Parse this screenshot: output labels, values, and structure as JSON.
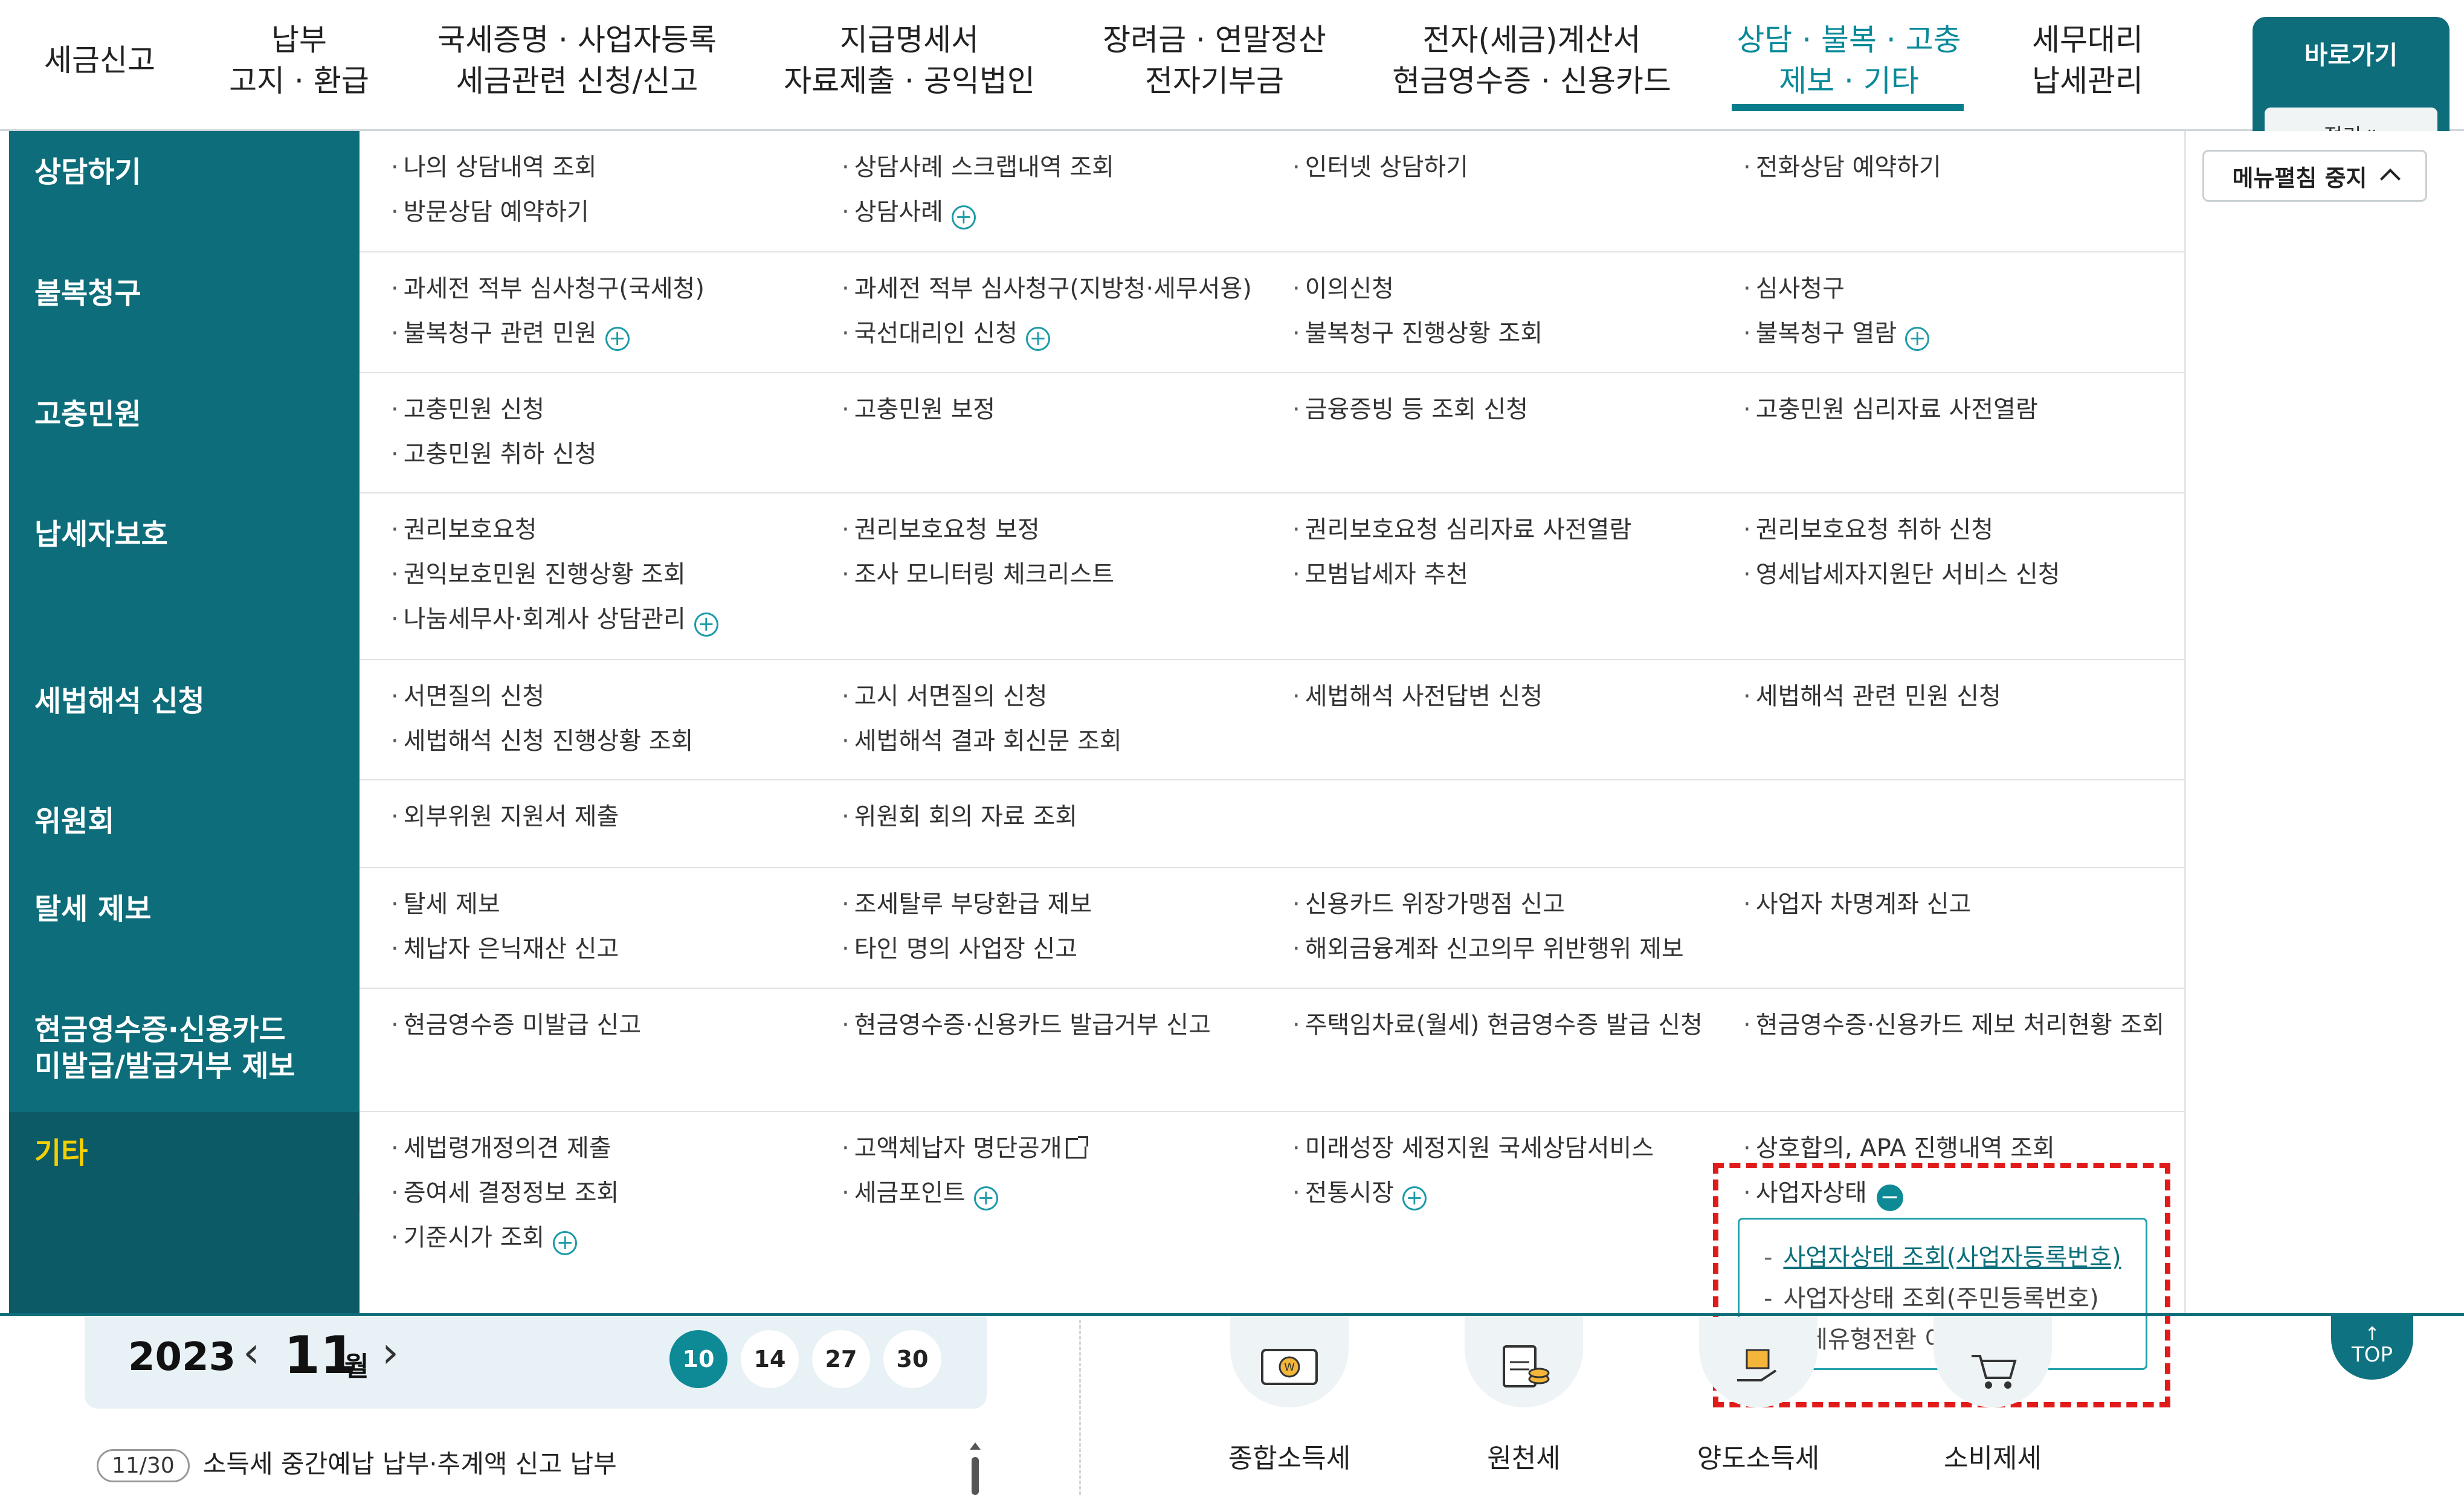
{
  "nav": {
    "items": [
      {
        "line1": "세금신고",
        "line2": ""
      },
      {
        "line1": "납부",
        "line2": "고지 · 환급"
      },
      {
        "line1": "국세증명 · 사업자등록",
        "line2": "세금관련 신청/신고"
      },
      {
        "line1": "지급명세서",
        "line2": "자료제출 · 공익법인"
      },
      {
        "line1": "장려금 · 연말정산",
        "line2": "전자기부금"
      },
      {
        "line1": "전자(세금)계산서",
        "line2": "현금영수증 · 신용카드"
      },
      {
        "line1": "상담 · 불복 · 고충",
        "line2": "제보 · 기타"
      },
      {
        "line1": "세무대리",
        "line2": "납세관리"
      }
    ],
    "goto_label": "바로가기",
    "goto_sub": "접기"
  },
  "menu": {
    "categories": [
      {
        "label": "상담하기",
        "items": [
          [
            "나의 상담내역 조회",
            ""
          ],
          [
            "방문상담 예약하기",
            ""
          ],
          [
            "상담사례 스크랩내역 조회",
            ""
          ],
          [
            "상담사례",
            "+"
          ],
          [
            "인터넷 상담하기",
            ""
          ],
          [
            "전화상담 예약하기",
            ""
          ]
        ]
      },
      {
        "label": "불복청구",
        "items": [
          [
            "과세전 적부 심사청구(국세청)",
            ""
          ],
          [
            "불복청구 관련 민원",
            "+"
          ],
          [
            "과세전 적부 심사청구(지방청·세무서용)",
            ""
          ],
          [
            "국선대리인 신청",
            "+"
          ],
          [
            "이의신청",
            ""
          ],
          [
            "불복청구 진행상황 조회",
            ""
          ],
          [
            "심사청구",
            ""
          ],
          [
            "불복청구 열람",
            "+"
          ]
        ]
      },
      {
        "label": "고충민원",
        "items": [
          [
            "고충민원 신청",
            ""
          ],
          [
            "고충민원 취하 신청",
            ""
          ],
          [
            "고충민원 보정",
            ""
          ],
          [
            "금융증빙 등 조회 신청",
            ""
          ],
          [
            "고충민원 심리자료 사전열람",
            ""
          ]
        ]
      },
      {
        "label": "납세자보호",
        "items": [
          [
            "권리보호요청",
            ""
          ],
          [
            "권익보호민원 진행상황 조회",
            ""
          ],
          [
            "나눔세무사·회계사 상담관리",
            "+"
          ],
          [
            "권리보호요청 보정",
            ""
          ],
          [
            "조사 모니터링 체크리스트",
            ""
          ],
          [
            "권리보호요청 심리자료 사전열람",
            ""
          ],
          [
            "모범납세자 추천",
            ""
          ],
          [
            "권리보호요청 취하 신청",
            ""
          ],
          [
            "영세납세자지원단 서비스 신청",
            ""
          ]
        ]
      },
      {
        "label": "세법해석 신청",
        "items": [
          [
            "서면질의 신청",
            ""
          ],
          [
            "세법해석 신청 진행상황 조회",
            ""
          ],
          [
            "고시 서면질의 신청",
            ""
          ],
          [
            "세법해석 결과 회신문 조회",
            ""
          ],
          [
            "세법해석 사전답변 신청",
            ""
          ],
          [
            "세법해석 관련 민원 신청",
            ""
          ]
        ]
      },
      {
        "label": "위원회",
        "items": [
          [
            "외부위원 지원서 제출",
            ""
          ],
          [
            "위원회 회의 자료 조회",
            ""
          ]
        ]
      },
      {
        "label": "탈세 제보",
        "items": [
          [
            "탈세 제보",
            ""
          ],
          [
            "체납자 은닉재산 신고",
            ""
          ],
          [
            "조세탈루 부당환급 제보",
            ""
          ],
          [
            "타인 명의 사업장 신고",
            ""
          ],
          [
            "신용카드 위장가맹점 신고",
            ""
          ],
          [
            "해외금융계좌 신고의무 위반행위 제보",
            ""
          ],
          [
            "사업자 차명계좌 신고",
            ""
          ]
        ]
      },
      {
        "label": "현금영수증·신용카드\n미발급/발급거부 제보",
        "items": [
          [
            "현금영수증 미발급 신고",
            ""
          ],
          [
            "현금영수증·신용카드 발급거부 신고",
            ""
          ],
          [
            "주택임차료(월세) 현금영수증 발급 신청",
            ""
          ],
          [
            "현금영수증·신용카드 제보 처리현황 조회",
            ""
          ]
        ]
      },
      {
        "label": "기타",
        "items": [
          [
            "세법령개정의견 제출",
            ""
          ],
          [
            "증여세 결정정보 조회",
            ""
          ],
          [
            "기준시가 조회",
            "+"
          ],
          [
            "고액체납자 명단공개",
            "ext"
          ],
          [
            "세금포인트",
            "+"
          ],
          [
            "미래성장 세정지원 국세상담서비스",
            ""
          ],
          [
            "전통시장",
            "+"
          ],
          [
            "상호합의, APA 진행내역 조회",
            ""
          ],
          [
            "사업자상태",
            "-"
          ]
        ]
      }
    ],
    "subpopup": [
      "사업자상태 조회(사업자등록번호)",
      "사업자상태 조회(주민등록번호)",
      "과세유형전환 이력 조회"
    ],
    "edit_button": "메뉴펼침 중지"
  },
  "calendar": {
    "year": "2023",
    "month": "11",
    "month_unit": "월",
    "days": [
      "10",
      "14",
      "27",
      "30"
    ],
    "selected_day": "10",
    "schedule_date": "11/30",
    "schedule_text": "소득세 중간예납 납부·추계액 신고 납부"
  },
  "services": [
    "종합소득세",
    "원천세",
    "양도소득세",
    "소비제세"
  ],
  "top_button": "TOP",
  "colors": {
    "primary": "#0e6d7a",
    "accent": "#0a8a99",
    "active_category": "#f5d000",
    "highlight": "#e11a1a"
  }
}
